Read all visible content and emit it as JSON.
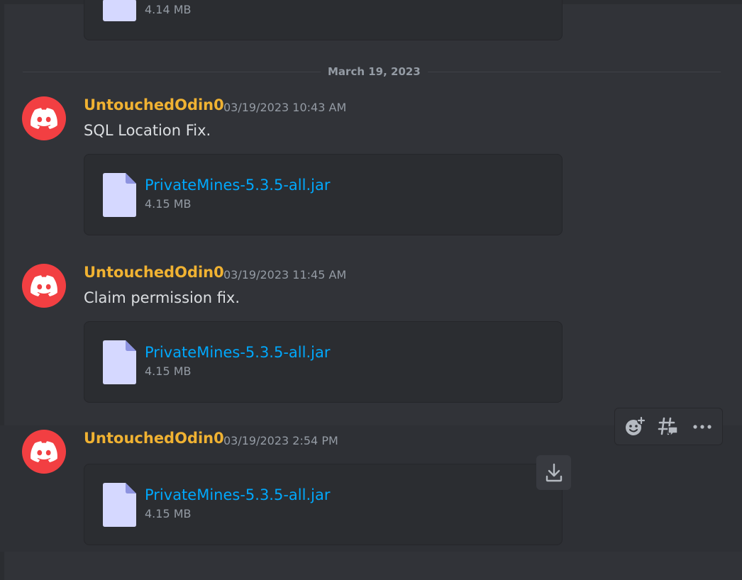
{
  "previous_attachment": {
    "size": "4.14 MB"
  },
  "date_divider": "March 19, 2023",
  "messages": [
    {
      "author": "UntouchedOdin0",
      "timestamp": "03/19/2023 10:43 AM",
      "content": "SQL Location Fix.",
      "attachment": {
        "filename": "PrivateMines-5.3.5-all.jar",
        "size": "4.15 MB"
      }
    },
    {
      "author": "UntouchedOdin0",
      "timestamp": "03/19/2023 11:45 AM",
      "content": "Claim permission fix.",
      "attachment": {
        "filename": "PrivateMines-5.3.5-all.jar",
        "size": "4.15 MB"
      }
    },
    {
      "author": "UntouchedOdin0",
      "timestamp": "03/19/2023 2:54 PM",
      "content": "",
      "attachment": {
        "filename": "PrivateMines-5.3.5-all.jar",
        "size": "4.15 MB"
      }
    }
  ],
  "toolbar": {
    "icons": [
      "add-reaction-icon",
      "create-thread-icon",
      "more-icon"
    ]
  },
  "colors": {
    "background": "#313338",
    "attachment_bg": "#2b2d31",
    "author": "#f0b232",
    "link": "#00a8fc",
    "avatar": "#f23f42",
    "muted": "#949ba4"
  }
}
